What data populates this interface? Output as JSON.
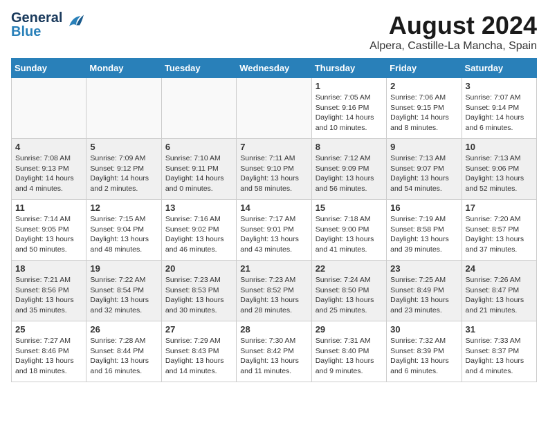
{
  "header": {
    "logo_general": "General",
    "logo_blue": "Blue",
    "month_year": "August 2024",
    "location": "Alpera, Castille-La Mancha, Spain"
  },
  "days_of_week": [
    "Sunday",
    "Monday",
    "Tuesday",
    "Wednesday",
    "Thursday",
    "Friday",
    "Saturday"
  ],
  "weeks": [
    [
      {
        "day": "",
        "content": ""
      },
      {
        "day": "",
        "content": ""
      },
      {
        "day": "",
        "content": ""
      },
      {
        "day": "",
        "content": ""
      },
      {
        "day": "1",
        "content": "Sunrise: 7:05 AM\nSunset: 9:16 PM\nDaylight: 14 hours\nand 10 minutes."
      },
      {
        "day": "2",
        "content": "Sunrise: 7:06 AM\nSunset: 9:15 PM\nDaylight: 14 hours\nand 8 minutes."
      },
      {
        "day": "3",
        "content": "Sunrise: 7:07 AM\nSunset: 9:14 PM\nDaylight: 14 hours\nand 6 minutes."
      }
    ],
    [
      {
        "day": "4",
        "content": "Sunrise: 7:08 AM\nSunset: 9:13 PM\nDaylight: 14 hours\nand 4 minutes."
      },
      {
        "day": "5",
        "content": "Sunrise: 7:09 AM\nSunset: 9:12 PM\nDaylight: 14 hours\nand 2 minutes."
      },
      {
        "day": "6",
        "content": "Sunrise: 7:10 AM\nSunset: 9:11 PM\nDaylight: 14 hours\nand 0 minutes."
      },
      {
        "day": "7",
        "content": "Sunrise: 7:11 AM\nSunset: 9:10 PM\nDaylight: 13 hours\nand 58 minutes."
      },
      {
        "day": "8",
        "content": "Sunrise: 7:12 AM\nSunset: 9:09 PM\nDaylight: 13 hours\nand 56 minutes."
      },
      {
        "day": "9",
        "content": "Sunrise: 7:13 AM\nSunset: 9:07 PM\nDaylight: 13 hours\nand 54 minutes."
      },
      {
        "day": "10",
        "content": "Sunrise: 7:13 AM\nSunset: 9:06 PM\nDaylight: 13 hours\nand 52 minutes."
      }
    ],
    [
      {
        "day": "11",
        "content": "Sunrise: 7:14 AM\nSunset: 9:05 PM\nDaylight: 13 hours\nand 50 minutes."
      },
      {
        "day": "12",
        "content": "Sunrise: 7:15 AM\nSunset: 9:04 PM\nDaylight: 13 hours\nand 48 minutes."
      },
      {
        "day": "13",
        "content": "Sunrise: 7:16 AM\nSunset: 9:02 PM\nDaylight: 13 hours\nand 46 minutes."
      },
      {
        "day": "14",
        "content": "Sunrise: 7:17 AM\nSunset: 9:01 PM\nDaylight: 13 hours\nand 43 minutes."
      },
      {
        "day": "15",
        "content": "Sunrise: 7:18 AM\nSunset: 9:00 PM\nDaylight: 13 hours\nand 41 minutes."
      },
      {
        "day": "16",
        "content": "Sunrise: 7:19 AM\nSunset: 8:58 PM\nDaylight: 13 hours\nand 39 minutes."
      },
      {
        "day": "17",
        "content": "Sunrise: 7:20 AM\nSunset: 8:57 PM\nDaylight: 13 hours\nand 37 minutes."
      }
    ],
    [
      {
        "day": "18",
        "content": "Sunrise: 7:21 AM\nSunset: 8:56 PM\nDaylight: 13 hours\nand 35 minutes."
      },
      {
        "day": "19",
        "content": "Sunrise: 7:22 AM\nSunset: 8:54 PM\nDaylight: 13 hours\nand 32 minutes."
      },
      {
        "day": "20",
        "content": "Sunrise: 7:23 AM\nSunset: 8:53 PM\nDaylight: 13 hours\nand 30 minutes."
      },
      {
        "day": "21",
        "content": "Sunrise: 7:23 AM\nSunset: 8:52 PM\nDaylight: 13 hours\nand 28 minutes."
      },
      {
        "day": "22",
        "content": "Sunrise: 7:24 AM\nSunset: 8:50 PM\nDaylight: 13 hours\nand 25 minutes."
      },
      {
        "day": "23",
        "content": "Sunrise: 7:25 AM\nSunset: 8:49 PM\nDaylight: 13 hours\nand 23 minutes."
      },
      {
        "day": "24",
        "content": "Sunrise: 7:26 AM\nSunset: 8:47 PM\nDaylight: 13 hours\nand 21 minutes."
      }
    ],
    [
      {
        "day": "25",
        "content": "Sunrise: 7:27 AM\nSunset: 8:46 PM\nDaylight: 13 hours\nand 18 minutes."
      },
      {
        "day": "26",
        "content": "Sunrise: 7:28 AM\nSunset: 8:44 PM\nDaylight: 13 hours\nand 16 minutes."
      },
      {
        "day": "27",
        "content": "Sunrise: 7:29 AM\nSunset: 8:43 PM\nDaylight: 13 hours\nand 14 minutes."
      },
      {
        "day": "28",
        "content": "Sunrise: 7:30 AM\nSunset: 8:42 PM\nDaylight: 13 hours\nand 11 minutes."
      },
      {
        "day": "29",
        "content": "Sunrise: 7:31 AM\nSunset: 8:40 PM\nDaylight: 13 hours\nand 9 minutes."
      },
      {
        "day": "30",
        "content": "Sunrise: 7:32 AM\nSunset: 8:39 PM\nDaylight: 13 hours\nand 6 minutes."
      },
      {
        "day": "31",
        "content": "Sunrise: 7:33 AM\nSunset: 8:37 PM\nDaylight: 13 hours\nand 4 minutes."
      }
    ]
  ]
}
